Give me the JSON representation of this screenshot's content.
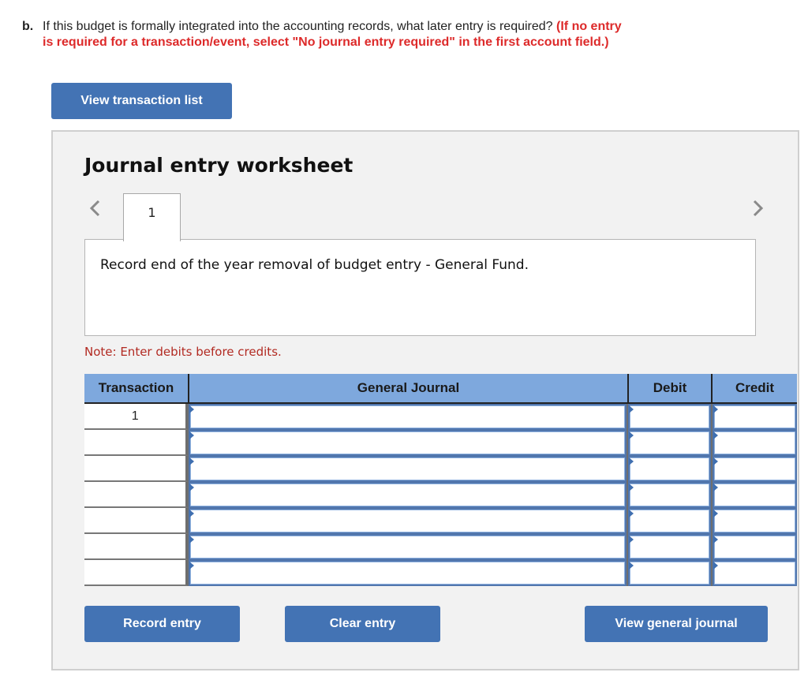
{
  "question": {
    "label": "b.",
    "text": "If this budget is formally integrated into the accounting records, what later entry is required?",
    "hint_line1": "(If no entry",
    "hint_line2": "is required for a transaction/event, select \"No journal entry required\" in the first account field.)"
  },
  "buttons": {
    "view_transaction_list": "View transaction list",
    "record_entry": "Record entry",
    "clear_entry": "Clear entry",
    "view_general_journal": "View general journal"
  },
  "worksheet": {
    "title": "Journal entry worksheet",
    "prev_icon": "chevron-left-icon",
    "next_icon": "chevron-right-icon",
    "tabs": [
      {
        "label": "1"
      }
    ],
    "description": "Record end of the year removal of budget entry - General Fund.",
    "note": "Note: Enter debits before credits."
  },
  "journal": {
    "headers": {
      "transaction": "Transaction",
      "account": "General Journal",
      "debit": "Debit",
      "credit": "Credit"
    },
    "rows": [
      {
        "transaction": "1",
        "account": "",
        "debit": "",
        "credit": ""
      },
      {
        "transaction": "",
        "account": "",
        "debit": "",
        "credit": ""
      },
      {
        "transaction": "",
        "account": "",
        "debit": "",
        "credit": ""
      },
      {
        "transaction": "",
        "account": "",
        "debit": "",
        "credit": ""
      },
      {
        "transaction": "",
        "account": "",
        "debit": "",
        "credit": ""
      },
      {
        "transaction": "",
        "account": "",
        "debit": "",
        "credit": ""
      },
      {
        "transaction": "",
        "account": "",
        "debit": "",
        "credit": ""
      }
    ]
  },
  "colors": {
    "button": "#4373b4",
    "header": "#7ea8dd",
    "hint": "#dd2a2a",
    "note": "#b22a22"
  }
}
